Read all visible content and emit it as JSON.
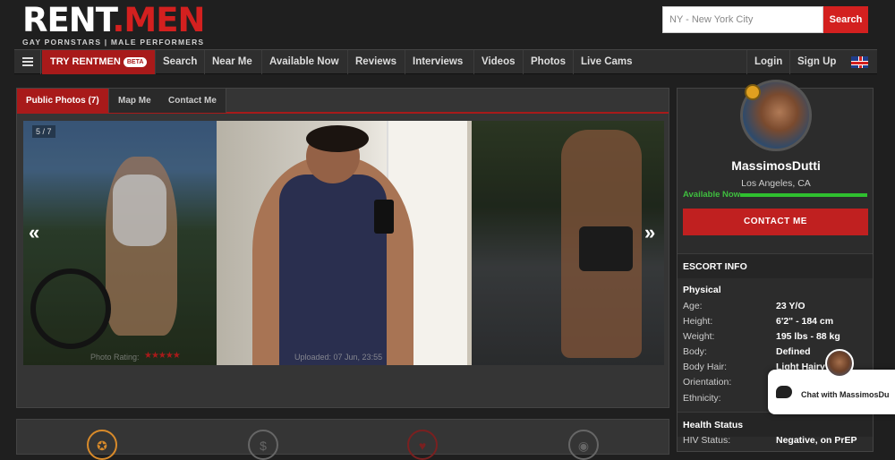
{
  "header": {
    "logo_prefix": "RENT",
    "logo_suffix": ".MEN",
    "tagline": "GAY PORNSTARS | MALE PERFORMERS",
    "search_placeholder": "NY - New York City",
    "search_button": "Search"
  },
  "nav": {
    "try_label": "TRY RENTMEN",
    "beta": "BETA",
    "items": [
      "Search",
      "Near Me",
      "Available Now",
      "Reviews",
      "Interviews",
      "Videos",
      "Photos",
      "Live Cams"
    ],
    "login": "Login",
    "signup": "Sign Up"
  },
  "tabs": [
    "Public Photos (7)",
    "Map Me",
    "Contact Me"
  ],
  "gallery": {
    "counter": "5 / 7",
    "prev": "«",
    "next": "»",
    "rating_label": "Photo Rating:",
    "stars": "★★★★★",
    "uploaded": "Uploaded: 07 Jun, 23:55"
  },
  "profile": {
    "name": "MassimosDutti",
    "location": "Los Angeles, CA",
    "availability": "Available Now",
    "contact_button": "CONTACT ME"
  },
  "escort_info": {
    "title": "ESCORT INFO",
    "physical_title": "Physical",
    "rows": [
      {
        "k": "Age:",
        "v": "23 Y/O"
      },
      {
        "k": "Height:",
        "v": "6'2\" - 184 cm"
      },
      {
        "k": "Weight:",
        "v": "195 lbs - 88 kg"
      },
      {
        "k": "Body:",
        "v": "Defined"
      },
      {
        "k": "Body Hair:",
        "v": "Light Hairy"
      },
      {
        "k": "Orientation:",
        "v": ""
      },
      {
        "k": "Ethnicity:",
        "v": ""
      }
    ],
    "health_title": "Health Status",
    "hiv_label": "HIV Status:",
    "hiv_value": "Negative, on PrEP"
  },
  "chat": {
    "label": "Chat with MassimosDu"
  },
  "colors": {
    "brand_red": "#d3201f",
    "available_green": "#2fc02f"
  }
}
